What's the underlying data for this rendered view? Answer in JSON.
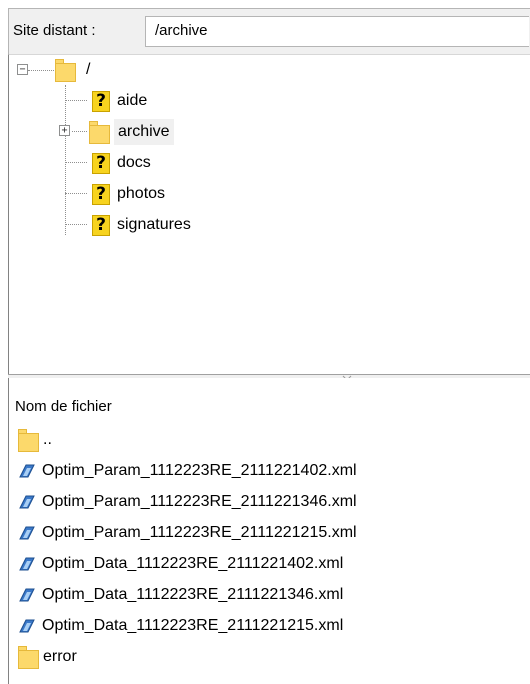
{
  "remote_site": {
    "label": "Site distant :",
    "path": "/archive"
  },
  "tree": {
    "root": {
      "label": "/",
      "expander": "−"
    },
    "items": [
      {
        "label": "aide",
        "icon": "question-folder-icon"
      },
      {
        "label": "archive",
        "icon": "folder-icon",
        "expander": "+",
        "selected": true
      },
      {
        "label": "docs",
        "icon": "question-folder-icon"
      },
      {
        "label": "photos",
        "icon": "question-folder-icon"
      },
      {
        "label": "signatures",
        "icon": "question-folder-icon"
      }
    ]
  },
  "file_list": {
    "column_header": "Nom de fichier",
    "parent_dir": "..",
    "files": [
      {
        "name": "Optim_Param_1112223RE_2111221402.xml",
        "icon": "xml-file-icon"
      },
      {
        "name": "Optim_Param_1112223RE_2111221346.xml",
        "icon": "xml-file-icon"
      },
      {
        "name": "Optim_Param_1112223RE_2111221215.xml",
        "icon": "xml-file-icon"
      },
      {
        "name": "Optim_Data_1112223RE_2111221402.xml",
        "icon": "xml-file-icon"
      },
      {
        "name": "Optim_Data_1112223RE_2111221346.xml",
        "icon": "xml-file-icon"
      },
      {
        "name": "Optim_Data_1112223RE_2111221215.xml",
        "icon": "xml-file-icon"
      }
    ],
    "folder_entries": [
      {
        "name": "error",
        "icon": "folder-icon"
      }
    ]
  },
  "colors": {
    "folder_fill": "#fcd96b",
    "question_fill": "#f7d31f",
    "selection_bg": "#f0f0f0",
    "xml_icon_blue": "#3a78c9"
  }
}
